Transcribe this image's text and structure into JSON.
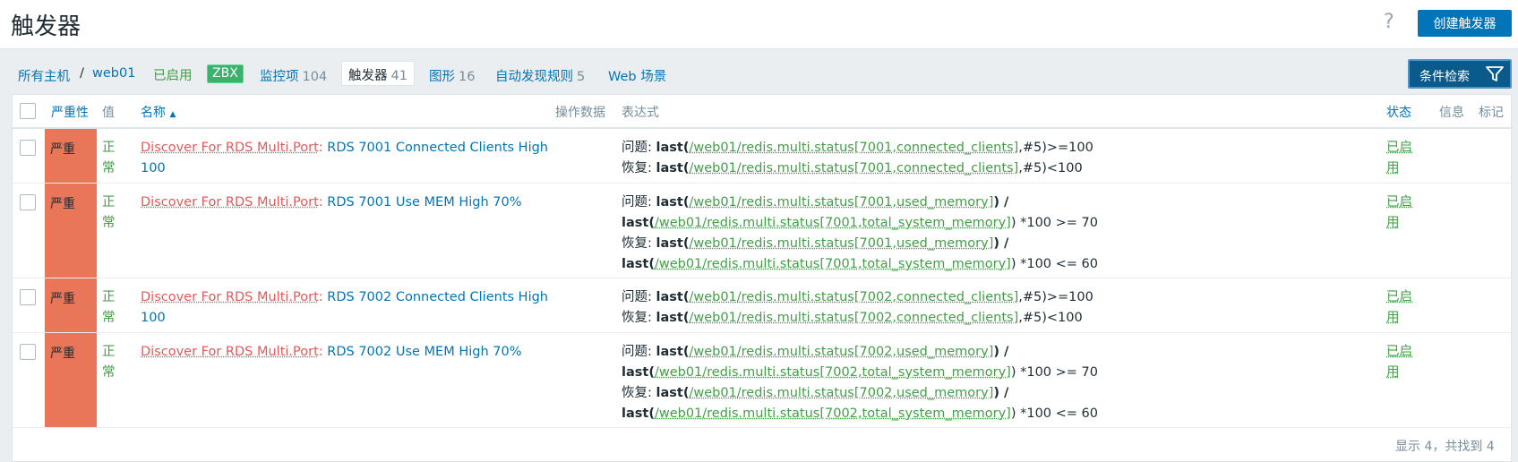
{
  "header": {
    "title": "触发器",
    "help_glyph": "?",
    "create_button": "创建触发器"
  },
  "nav": {
    "all_hosts": "所有主机",
    "separator": "/",
    "host": "web01",
    "enabled": "已启用",
    "zbx": "ZBX",
    "items_label": "监控项",
    "items_count": "104",
    "triggers_label": "触发器",
    "triggers_count": "41",
    "graphs_label": "图形",
    "graphs_count": "16",
    "discovery_label": "自动发现规则",
    "discovery_count": "5",
    "web_label": "Web 场景"
  },
  "filter_button": "条件检索",
  "columns": {
    "severity": "严重性",
    "value": "值",
    "name": "名称",
    "sort_arrow": "▲",
    "operational_data": "操作数据",
    "expression": "表达式",
    "status": "状态",
    "info": "信息",
    "tags": "标记"
  },
  "rows": [
    {
      "severity": "严重",
      "value": "正常",
      "rule": "Discover For RDS Multi.Port",
      "colon": ":",
      "trigger": "RDS 7001 Connected Clients High 100",
      "problem_label": "问题: ",
      "p_fn": "last(",
      "p_item": "/web01/redis.multi.status[7001,connected_clients]",
      "p_tail": ",#5)>=100",
      "recovery_label": "恢复: ",
      "r_fn": "last(",
      "r_item": "/web01/redis.multi.status[7001,connected_clients]",
      "r_tail": ",#5)<100",
      "status": "已启用"
    },
    {
      "severity": "严重",
      "value": "正常",
      "rule": "Discover For RDS Multi.Port",
      "colon": ":",
      "trigger": "RDS 7001 Use MEM High 70%",
      "problem_label": "问题: ",
      "p_fn1": "last(",
      "p_item1": "/web01/redis.multi.status[7001,used_memory]",
      "p_mid": ") / ",
      "p_fn2": "last(",
      "p_item2": "/web01/redis.multi.status[7001,total_system_memory]",
      "p_tail": ") *100 >= 70",
      "recovery_label": "恢复: ",
      "r_fn1": "last(",
      "r_item1": "/web01/redis.multi.status[7001,used_memory]",
      "r_mid": ") / ",
      "r_fn2": "last(",
      "r_item2": "/web01/redis.multi.status[7001,total_system_memory]",
      "r_tail": ") *100 <= 60",
      "status": "已启用"
    },
    {
      "severity": "严重",
      "value": "正常",
      "rule": "Discover For RDS Multi.Port",
      "colon": ":",
      "trigger": "RDS 7002 Connected Clients High 100",
      "problem_label": "问题: ",
      "p_fn": "last(",
      "p_item": "/web01/redis.multi.status[7002,connected_clients]",
      "p_tail": ",#5)>=100",
      "recovery_label": "恢复: ",
      "r_fn": "last(",
      "r_item": "/web01/redis.multi.status[7002,connected_clients]",
      "r_tail": ",#5)<100",
      "status": "已启用"
    },
    {
      "severity": "严重",
      "value": "正常",
      "rule": "Discover For RDS Multi.Port",
      "colon": ":",
      "trigger": "RDS 7002 Use MEM High 70%",
      "problem_label": "问题: ",
      "p_fn1": "last(",
      "p_item1": "/web01/redis.multi.status[7002,used_memory]",
      "p_mid": ") / ",
      "p_fn2": "last(",
      "p_item2": "/web01/redis.multi.status[7002,total_system_memory]",
      "p_tail": ") *100 >= 70",
      "recovery_label": "恢复: ",
      "r_fn1": "last(",
      "r_item1": "/web01/redis.multi.status[7002,used_memory]",
      "r_mid": ") / ",
      "r_fn2": "last(",
      "r_item2": "/web01/redis.multi.status[7002,total_system_memory]",
      "r_tail": ") *100 <= 60",
      "status": "已启用"
    }
  ],
  "footer": "显示 4，共找到 4",
  "colors": {
    "accent": "#0275b8",
    "severity_high": "#e97659",
    "ok_green": "#429e47",
    "rule_red": "#e45959"
  }
}
